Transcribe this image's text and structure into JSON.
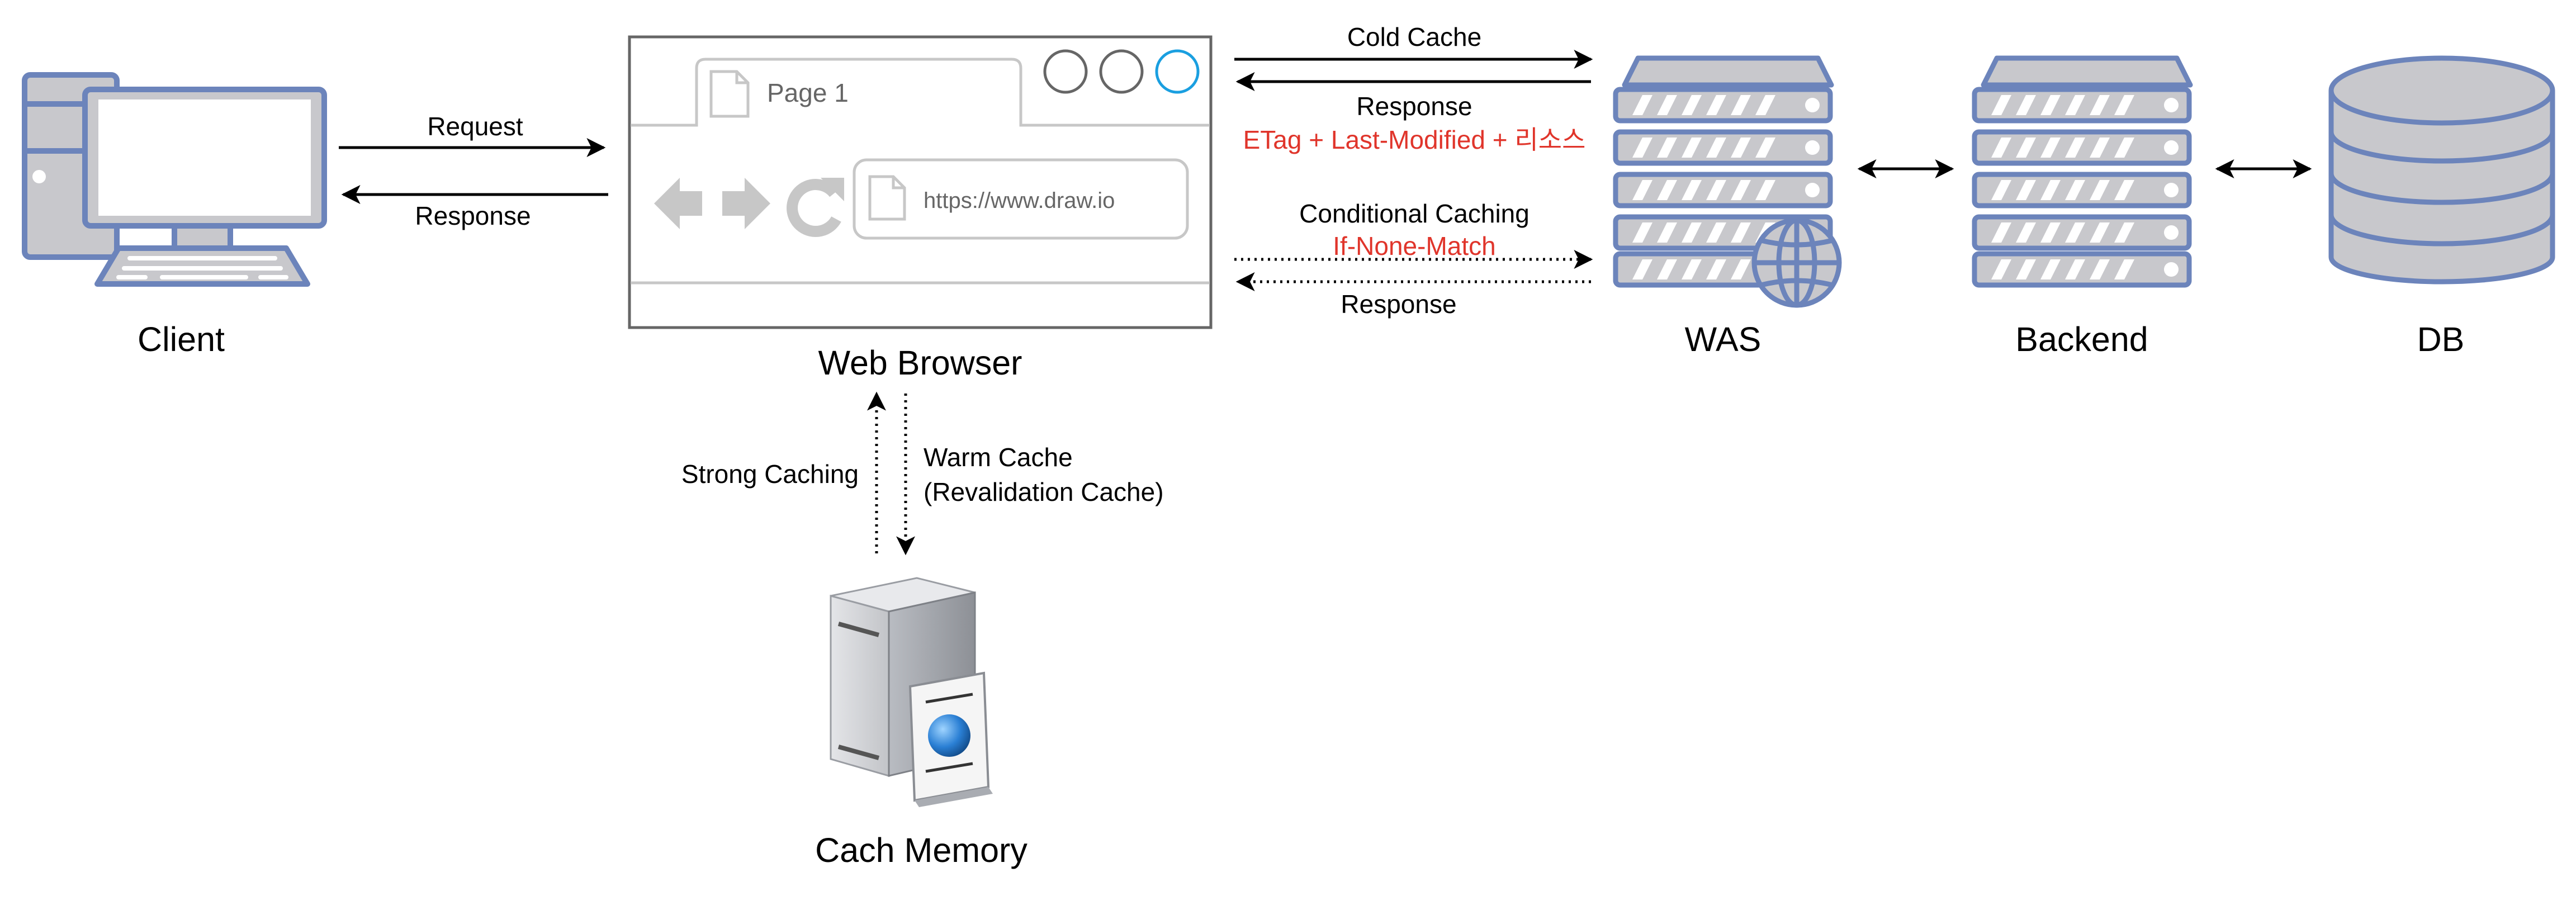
{
  "nodes": {
    "client": {
      "label": "Client"
    },
    "browser": {
      "label": "Web Browser",
      "tab_label": "Page 1",
      "url": "https://www.draw.io"
    },
    "was": {
      "label": "WAS"
    },
    "backend": {
      "label": "Backend"
    },
    "db": {
      "label": "DB"
    },
    "cache": {
      "label": "Cach Memory"
    }
  },
  "edges": {
    "client_browser": {
      "request": "Request",
      "response": "Response"
    },
    "cold": {
      "label": "Cold Cache",
      "response": "Response",
      "response_detail": "ETag + Last-Modified + 리소스"
    },
    "conditional": {
      "label": "Conditional Caching",
      "detail": "If-None-Match",
      "response": "Response"
    },
    "cache_link": {
      "strong": "Strong Caching",
      "warm_line1": "Warm Cache",
      "warm_line2": "(Revalidation Cache)"
    }
  },
  "colors": {
    "node_stroke": "#6c84bb",
    "node_fill": "#ffffff",
    "server_fill": "#c8c8cc",
    "highlight_text": "#e0352b",
    "browser_gray": "#c7c7c7",
    "active_circle": "#1a9fe0"
  },
  "icons": [
    "desktop-computer-icon",
    "browser-window-icon",
    "server-rack-icon",
    "web-server-globe-icon",
    "database-icon",
    "cache-server-icon"
  ]
}
